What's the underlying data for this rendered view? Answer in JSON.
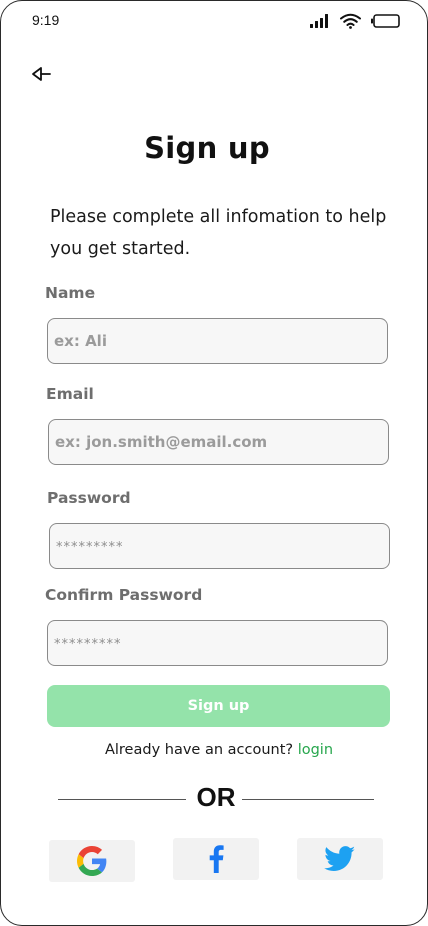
{
  "status_bar": {
    "time": "9:19"
  },
  "header": {
    "title": "Sign up"
  },
  "intro": {
    "text": "Please complete all infomation to help you get started."
  },
  "form": {
    "name": {
      "label": "Name",
      "placeholder": "ex: Ali",
      "value": ""
    },
    "email": {
      "label": "Email",
      "placeholder": "ex: jon.smith@email.com",
      "value": ""
    },
    "password": {
      "label": "Password",
      "placeholder": "*********",
      "value": ""
    },
    "confirm_password": {
      "label": "Confirm Password",
      "placeholder": "*********",
      "value": ""
    },
    "submit_label": "Sign up"
  },
  "account": {
    "prompt": "Already have an account?",
    "login_label": "login"
  },
  "divider": {
    "text": "OR"
  },
  "social": [
    {
      "icon": "google-icon"
    },
    {
      "icon": "facebook-icon"
    },
    {
      "icon": "twitter-icon"
    }
  ],
  "colors": {
    "primary_button": "#94e3aa",
    "login_link": "#27a64d",
    "facebook": "#1877f2",
    "twitter": "#1da1f2"
  }
}
